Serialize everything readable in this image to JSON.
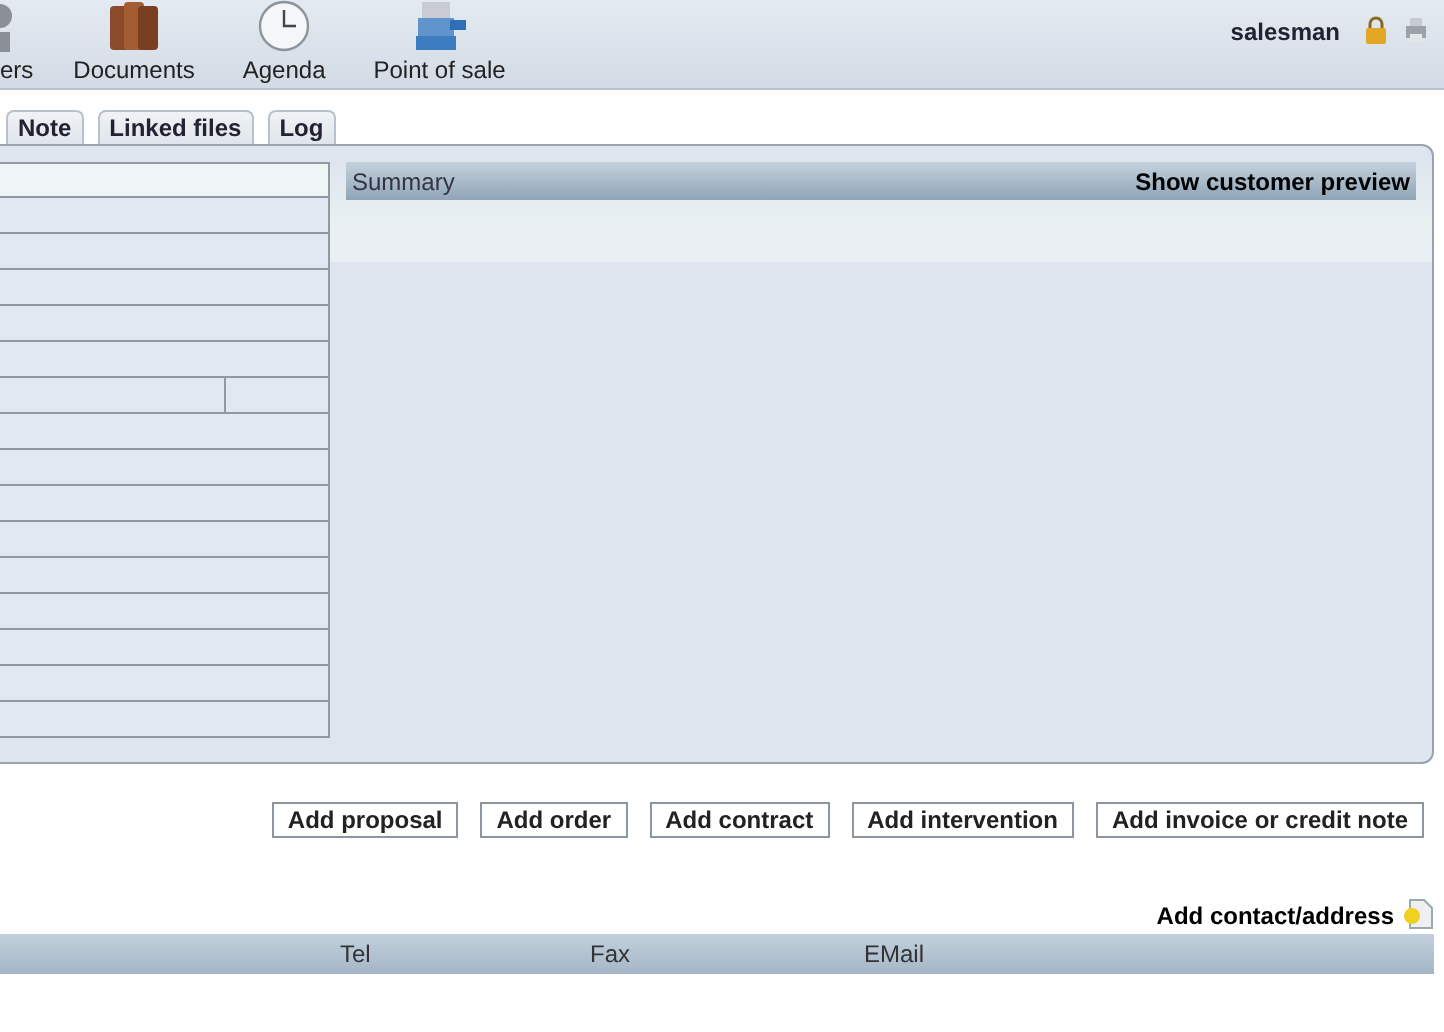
{
  "menu": [
    {
      "label": "ers"
    },
    {
      "label": "Documents"
    },
    {
      "label": "Agenda"
    },
    {
      "label": "Point of sale"
    }
  ],
  "user": {
    "name": "salesman"
  },
  "tabs": [
    {
      "label": "Note",
      "selected": false
    },
    {
      "label": "Linked files",
      "selected": false
    },
    {
      "label": "Log",
      "selected": false
    }
  ],
  "summary": {
    "title": "Summary",
    "action": "Show customer preview"
  },
  "actions": [
    "Add proposal",
    "Add order",
    "Add contract",
    "Add intervention",
    "Add invoice or credit note"
  ],
  "contacts": {
    "add_label": "Add contact/address",
    "columns": [
      "Tel",
      "Fax",
      "EMail"
    ]
  }
}
